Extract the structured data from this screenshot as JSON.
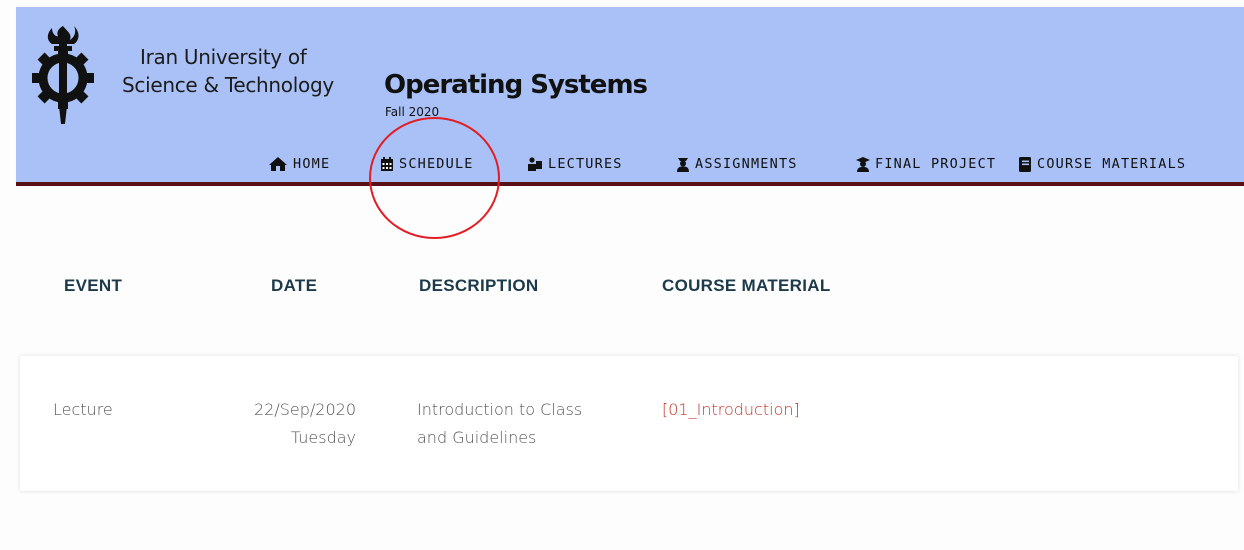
{
  "header": {
    "university_line1": "Iran University of",
    "university_line2": "Science & Technology",
    "course_title": "Operating Systems",
    "course_term": "Fall 2020",
    "bg_color": "#a9c1f7",
    "border_color": "#5a0f16"
  },
  "nav": {
    "items": [
      {
        "label": "HOME",
        "icon": "home-icon"
      },
      {
        "label": "SCHEDULE",
        "icon": "calendar-icon"
      },
      {
        "label": "LECTURES",
        "icon": "lectures-icon"
      },
      {
        "label": "ASSIGNMENTS",
        "icon": "assignments-icon"
      },
      {
        "label": "FINAL PROJECT",
        "icon": "final-project-icon"
      },
      {
        "label": "COURSE MATERIALS",
        "icon": "book-icon"
      }
    ]
  },
  "annotation": {
    "color": "#e21d24",
    "target": "SCHEDULE"
  },
  "table": {
    "headers": [
      "EVENT",
      "DATE",
      "DESCRIPTION",
      "COURSE MATERIAL"
    ],
    "rows": [
      {
        "event": "Lecture",
        "date": "22/Sep/2020",
        "day": "Tuesday",
        "description_line1": "Introduction to Class",
        "description_line2": "and Guidelines",
        "material": "[01_Introduction]"
      }
    ]
  }
}
